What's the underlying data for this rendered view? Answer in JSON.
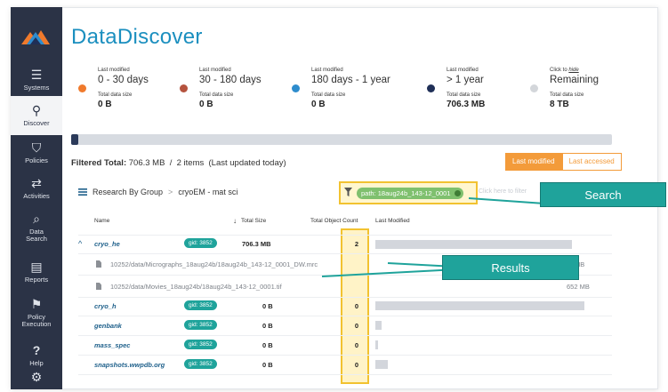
{
  "app": {
    "title": "DataDiscover"
  },
  "sidebar": {
    "items": [
      {
        "label": "Systems",
        "icon": "server-icon"
      },
      {
        "label": "Discover",
        "icon": "discover-icon",
        "active": true
      },
      {
        "label": "Policies",
        "icon": "shield-icon"
      },
      {
        "label": "Activities",
        "icon": "arrows-icon"
      },
      {
        "label": "Data\nSearch",
        "icon": "search-icon"
      },
      {
        "label": "Reports",
        "icon": "report-icon"
      },
      {
        "label": "Policy\nExecution",
        "icon": "run-icon"
      },
      {
        "label": "Help",
        "icon": "help-icon"
      },
      {
        "label": "",
        "icon": "gear-icon"
      }
    ]
  },
  "buckets": [
    {
      "caption": "Last modified",
      "range": "0 - 30 days",
      "size_caption": "Total data size",
      "size": "0 B",
      "color": "#f07a2c"
    },
    {
      "caption": "Last modified",
      "range": "30 - 180 days",
      "size_caption": "Total data size",
      "size": "0 B",
      "color": "#b5533e"
    },
    {
      "caption": "Last modified",
      "range": "180 days - 1 year",
      "size_caption": "Total data size",
      "size": "0 B",
      "color": "#2e8ccd"
    },
    {
      "caption": "Last modified",
      "range": "> 1 year",
      "size_caption": "Total data size",
      "size": "706.3 MB",
      "color": "#1f2f57"
    },
    {
      "caption_prefix": "Click to ",
      "caption_link": "hide",
      "range": "Remaining",
      "size_caption": "Total data size",
      "size": "8 TB",
      "color": "#d3d6da"
    }
  ],
  "usage": {
    "fraction": 0.013
  },
  "filtered": {
    "label": "Filtered Total:",
    "text": "706.3 MB  /  2 items  (Last updated today)"
  },
  "toggle": {
    "active": "Last modified",
    "inactive": "Last accessed"
  },
  "breadcrumb": {
    "root": "Research By Group",
    "sep": ">",
    "current": "cryoEM - mat sci"
  },
  "filter": {
    "chip": "path: 18aug24b_143-12_0001",
    "hint": "Click here to filter"
  },
  "callouts": {
    "search": "Search",
    "results": "Results"
  },
  "table": {
    "headers": {
      "name": "Name",
      "size": "Total Size",
      "count": "Total Object Count",
      "modified": "Last Modified"
    },
    "rows": [
      {
        "name": "cryo_he",
        "gid": "gid: 3852",
        "size": "706.3 MB",
        "count": "2",
        "bar": 0.92,
        "expanded": true,
        "expander": "^"
      },
      {
        "path": "10252/data/Micrographs_18aug24b/18aug24b_143-12_0001_DW.mrc",
        "size": "MB"
      },
      {
        "path": "10252/data/Movies_18aug24b/18aug24b_143-12_0001.tif",
        "size": "652 MB"
      },
      {
        "name": "cryo_h",
        "gid": "gid: 3852",
        "size": "0 B",
        "count": "0",
        "bar": 0.98
      },
      {
        "name": "genbank",
        "gid": "gid: 3852",
        "size": "0 B",
        "count": "0",
        "bar": 0.03
      },
      {
        "name": "mass_spec",
        "gid": "gid: 3852",
        "size": "0 B",
        "count": "0",
        "bar": 0.01
      },
      {
        "name": "snapshots.wwpdb.org",
        "gid": "gid: 3852",
        "size": "0 B",
        "count": "0",
        "bar": 0.06
      }
    ]
  }
}
